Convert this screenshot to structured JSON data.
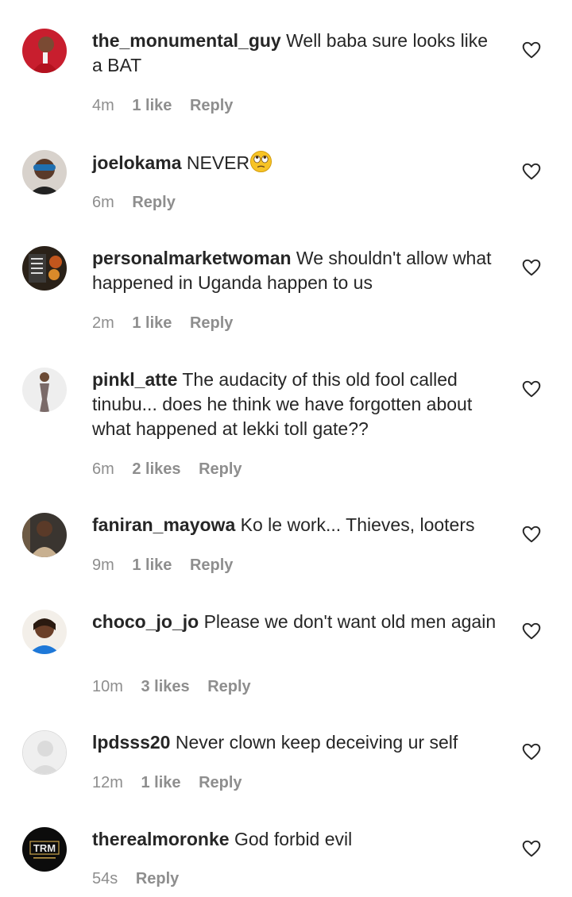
{
  "comments": [
    {
      "username": "the_monumental_guy",
      "text": "Well baba sure looks like a BAT",
      "time": "4m",
      "likes": "1 like",
      "reply": "Reply"
    },
    {
      "username": "joelokama",
      "text": "NEVER",
      "emoji": "🙄",
      "time": "6m",
      "likes": "",
      "reply": "Reply"
    },
    {
      "username": "personalmarketwoman",
      "text": "We shouldn't allow what happened in Uganda happen to us",
      "time": "2m",
      "likes": "1 like",
      "reply": "Reply"
    },
    {
      "username": "pinkl_atte",
      "text": "The audacity of this old fool called tinubu... does he think we have forgotten about what happened at lekki toll gate??",
      "time": "6m",
      "likes": "2 likes",
      "reply": "Reply"
    },
    {
      "username": "faniran_mayowa",
      "text": "Ko le work... Thieves, looters",
      "time": "9m",
      "likes": "1 like",
      "reply": "Reply"
    },
    {
      "username": "choco_jo_jo",
      "text": "Please we don't want old men again",
      "time": "10m",
      "likes": "3 likes",
      "reply": "Reply"
    },
    {
      "username": "lpdsss20",
      "text": "Never clown keep deceiving ur self",
      "time": "12m",
      "likes": "1 like",
      "reply": "Reply"
    },
    {
      "username": "therealmoronke",
      "text": "God forbid evil",
      "time": "54s",
      "likes": "",
      "reply": "Reply",
      "avatar_text": "TRM"
    }
  ],
  "icons": {
    "like": "heart-outline-icon",
    "avatar": "profile-photo"
  },
  "colors": {
    "text": "#262626",
    "meta": "#8e8e8e",
    "background": "#ffffff"
  }
}
